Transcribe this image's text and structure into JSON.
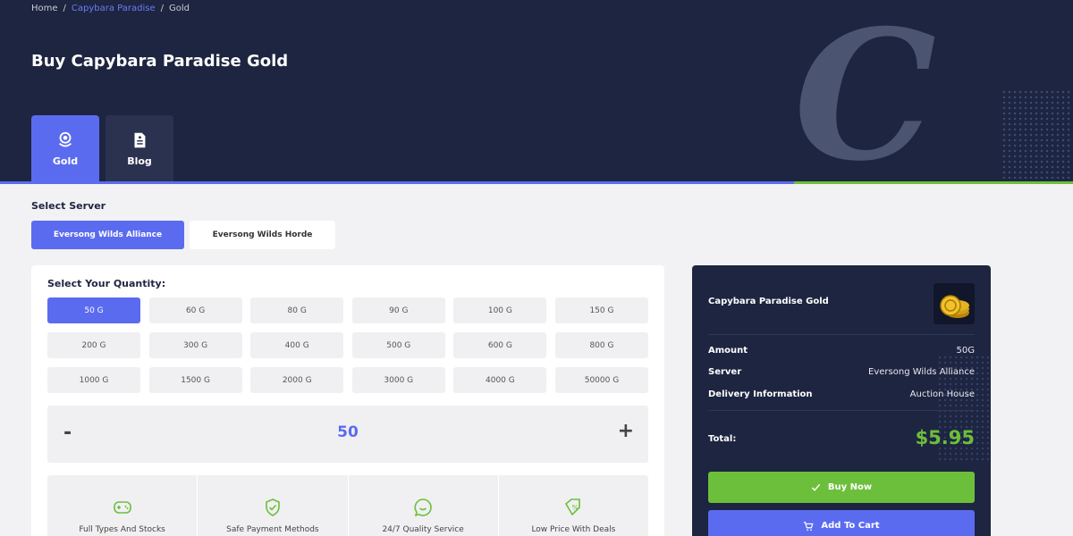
{
  "breadcrumb": {
    "home": "Home",
    "game": "Capybara Paradise",
    "current": "Gold",
    "sep": "/"
  },
  "page_title": "Buy Capybara Paradise Gold",
  "hero_letter": "C",
  "tabs": [
    {
      "label": "Gold",
      "icon": "gold-coins-icon",
      "active": true
    },
    {
      "label": "Blog",
      "icon": "document-icon",
      "active": false
    }
  ],
  "server": {
    "label": "Select Server",
    "options": [
      "Eversong Wilds Alliance",
      "Eversong Wilds Horde"
    ],
    "selected": "Eversong Wilds Alliance"
  },
  "quantity": {
    "label": "Select Your Quantity:",
    "options": [
      "50 G",
      "60 G",
      "80 G",
      "90 G",
      "100 G",
      "150 G",
      "200 G",
      "300 G",
      "400 G",
      "500 G",
      "600 G",
      "800 G",
      "1000 G",
      "1500 G",
      "2000 G",
      "3000 G",
      "4000 G",
      "50000 G"
    ],
    "selected": "50 G",
    "stepper": {
      "minus": "-",
      "value": "50",
      "plus": "+"
    }
  },
  "features": [
    {
      "label": "Full Types And Stocks",
      "icon": "gamepad-icon"
    },
    {
      "label": "Safe Payment Methods",
      "icon": "shield-check-icon"
    },
    {
      "label": "24/7 Quality Service",
      "icon": "chat-icon"
    },
    {
      "label": "Low Price With Deals",
      "icon": "discount-tag-icon"
    }
  ],
  "summary": {
    "product": "Capybara Paradise Gold",
    "rows": [
      {
        "key": "Amount",
        "value": "50G"
      },
      {
        "key": "Server",
        "value": "Eversong Wilds Alliance"
      },
      {
        "key": "Delivery Information",
        "value": "Auction House"
      }
    ],
    "total_label": "Total:",
    "total_price": "$5.95",
    "buy_label": "Buy Now",
    "cart_label": "Add To Cart"
  },
  "colors": {
    "primary": "#5b6bf0",
    "accent_green": "#6cbf3b",
    "dark_navy": "#1e2540"
  }
}
